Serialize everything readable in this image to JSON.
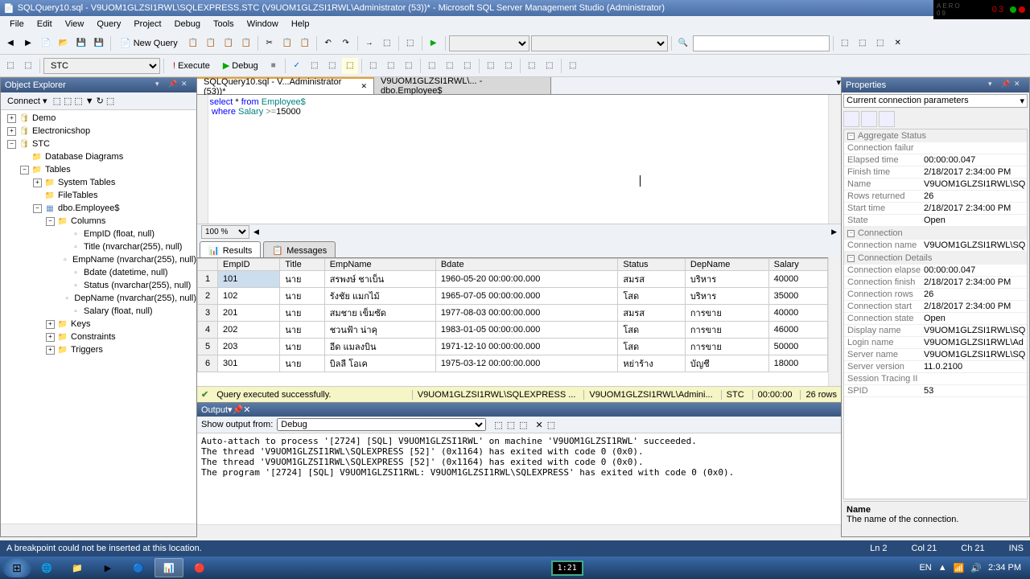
{
  "window": {
    "title": "SQLQuery10.sql - V9UOM1GLZSI1RWL\\SQLEXPRESS.STC (V9UOM1GLZSI1RWL\\Administrator (53))* - Microsoft SQL Server Management Studio (Administrator)"
  },
  "menu": [
    "File",
    "Edit",
    "View",
    "Query",
    "Project",
    "Debug",
    "Tools",
    "Window",
    "Help"
  ],
  "toolbar": {
    "new_query": "New Query",
    "db_combo": "STC",
    "execute": "Execute",
    "debug": "Debug"
  },
  "object_explorer": {
    "title": "Object Explorer",
    "connect": "Connect ▾",
    "tree": [
      {
        "depth": 0,
        "exp": "+",
        "icon": "db",
        "label": "Demo"
      },
      {
        "depth": 0,
        "exp": "+",
        "icon": "db",
        "label": "Electronicshop"
      },
      {
        "depth": 0,
        "exp": "−",
        "icon": "db",
        "label": "STC"
      },
      {
        "depth": 1,
        "exp": "",
        "icon": "folder",
        "label": "Database Diagrams"
      },
      {
        "depth": 1,
        "exp": "−",
        "icon": "folder",
        "label": "Tables"
      },
      {
        "depth": 2,
        "exp": "+",
        "icon": "folder",
        "label": "System Tables"
      },
      {
        "depth": 2,
        "exp": "",
        "icon": "folder",
        "label": "FileTables"
      },
      {
        "depth": 2,
        "exp": "−",
        "icon": "table",
        "label": "dbo.Employee$"
      },
      {
        "depth": 3,
        "exp": "−",
        "icon": "folder",
        "label": "Columns"
      },
      {
        "depth": 4,
        "exp": "",
        "icon": "col",
        "label": "EmpID (float, null)"
      },
      {
        "depth": 4,
        "exp": "",
        "icon": "col",
        "label": "Title (nvarchar(255), null)"
      },
      {
        "depth": 4,
        "exp": "",
        "icon": "col",
        "label": "EmpName (nvarchar(255), null)"
      },
      {
        "depth": 4,
        "exp": "",
        "icon": "col",
        "label": "Bdate (datetime, null)"
      },
      {
        "depth": 4,
        "exp": "",
        "icon": "col",
        "label": "Status (nvarchar(255), null)"
      },
      {
        "depth": 4,
        "exp": "",
        "icon": "col",
        "label": "DepName (nvarchar(255), null)"
      },
      {
        "depth": 4,
        "exp": "",
        "icon": "col",
        "label": "Salary (float, null)"
      },
      {
        "depth": 3,
        "exp": "+",
        "icon": "folder",
        "label": "Keys"
      },
      {
        "depth": 3,
        "exp": "+",
        "icon": "folder",
        "label": "Constraints"
      },
      {
        "depth": 3,
        "exp": "+",
        "icon": "folder",
        "label": "Triggers"
      }
    ]
  },
  "tabs": {
    "active": "SQLQuery10.sql - V...Administrator (53))*",
    "inactive": "V9UOM1GLZSI1RWL\\... - dbo.Employee$"
  },
  "sql": {
    "line1_p1": "select",
    "line1_p2": " * ",
    "line1_p3": "from",
    "line1_p4": " Employee$",
    "line2_p1": "where",
    "line2_p2": " Salary ",
    "line2_p3": ">=",
    "line2_p4": "15000"
  },
  "zoom": "100 %",
  "result_tabs": {
    "results": "Results",
    "messages": "Messages"
  },
  "grid": {
    "headers": [
      "",
      "EmpID",
      "Title",
      "EmpName",
      "Bdate",
      "Status",
      "DepName",
      "Salary"
    ],
    "rows": [
      [
        "1",
        "101",
        "นาย",
        "สรพงษ์ ชาเบ็น",
        "1960-05-20 00:00:00.000",
        "สมรส",
        "บริหาร",
        "40000"
      ],
      [
        "2",
        "102",
        "นาย",
        "รังชัย แมกไม้",
        "1965-07-05 00:00:00.000",
        "โสด",
        "บริหาร",
        "35000"
      ],
      [
        "3",
        "201",
        "นาย",
        "สมชาย เข็มซัด",
        "1977-08-03 00:00:00.000",
        "สมรส",
        "การขาย",
        "40000"
      ],
      [
        "4",
        "202",
        "นาย",
        "ชวนฟ้า น่าคุ",
        "1983-01-05 00:00:00.000",
        "โสด",
        "การขาย",
        "46000"
      ],
      [
        "5",
        "203",
        "นาย",
        "อีด แมลงบิน",
        "1971-12-10 00:00:00.000",
        "โสด",
        "การขาย",
        "50000"
      ],
      [
        "6",
        "301",
        "นาย",
        "บิลลี โอเค",
        "1975-03-12 00:00:00.000",
        "หย่าร้าง",
        "บัญชี",
        "18000"
      ]
    ]
  },
  "status_strip": {
    "msg": "Query executed successfully.",
    "server": "V9UOM1GLZSI1RWL\\SQLEXPRESS ...",
    "user": "V9UOM1GLZSI1RWL\\Admini...",
    "db": "STC",
    "time": "00:00:00",
    "rows": "26 rows"
  },
  "properties": {
    "title": "Properties",
    "combo": "Current connection parameters",
    "cats": {
      "agg": "Aggregate Status",
      "conn": "Connection",
      "det": "Connection Details"
    },
    "rows": [
      {
        "cat": "agg",
        "n": "Connection failur",
        "v": ""
      },
      {
        "cat": "agg",
        "n": "Elapsed time",
        "v": "00:00:00.047"
      },
      {
        "cat": "agg",
        "n": "Finish time",
        "v": "2/18/2017 2:34:00 PM"
      },
      {
        "cat": "agg",
        "n": "Name",
        "v": "V9UOM1GLZSI1RWL\\SQ"
      },
      {
        "cat": "agg",
        "n": "Rows returned",
        "v": "26"
      },
      {
        "cat": "agg",
        "n": "Start time",
        "v": "2/18/2017 2:34:00 PM"
      },
      {
        "cat": "agg",
        "n": "State",
        "v": "Open"
      },
      {
        "cat": "conn",
        "n": "Connection name",
        "v": "V9UOM1GLZSI1RWL\\SQ"
      },
      {
        "cat": "det",
        "n": "Connection elapse",
        "v": "00:00:00.047"
      },
      {
        "cat": "det",
        "n": "Connection finish",
        "v": "2/18/2017 2:34:00 PM"
      },
      {
        "cat": "det",
        "n": "Connection rows",
        "v": "26"
      },
      {
        "cat": "det",
        "n": "Connection start",
        "v": "2/18/2017 2:34:00 PM"
      },
      {
        "cat": "det",
        "n": "Connection state",
        "v": "Open"
      },
      {
        "cat": "det",
        "n": "Display name",
        "v": "V9UOM1GLZSI1RWL\\SQ"
      },
      {
        "cat": "det",
        "n": "Login name",
        "v": "V9UOM1GLZSI1RWL\\Ad"
      },
      {
        "cat": "det",
        "n": "Server name",
        "v": "V9UOM1GLZSI1RWL\\SQ"
      },
      {
        "cat": "det",
        "n": "Server version",
        "v": "11.0.2100"
      },
      {
        "cat": "det",
        "n": "Session Tracing II",
        "v": ""
      },
      {
        "cat": "det",
        "n": "SPID",
        "v": "53"
      }
    ],
    "desc_name": "Name",
    "desc_text": "The name of the connection."
  },
  "output": {
    "title": "Output",
    "from_label": "Show output from:",
    "from_value": "Debug",
    "lines": [
      "Auto-attach to process '[2724] [SQL] V9UOM1GLZSI1RWL' on machine 'V9UOM1GLZSI1RWL' succeeded.",
      "The thread 'V9UOM1GLZSI1RWL\\SQLEXPRESS [52]' (0x1164) has exited with code 0 (0x0).",
      "The thread 'V9UOM1GLZSI1RWL\\SQLEXPRESS [52]' (0x1164) has exited with code 0 (0x0).",
      "The program '[2724] [SQL] V9UOM1GLZSI1RWL: V9UOM1GLZSI1RWL\\SQLEXPRESS' has exited with code 0 (0x0)."
    ]
  },
  "statusbar": {
    "msg": "A breakpoint could not be inserted at this location.",
    "ln": "Ln 2",
    "col": "Col 21",
    "ch": "Ch 21",
    "ins": "INS"
  },
  "taskbar": {
    "timer": "1:21",
    "lang": "EN",
    "time": "2:34 PM"
  },
  "floating_clock": "03"
}
